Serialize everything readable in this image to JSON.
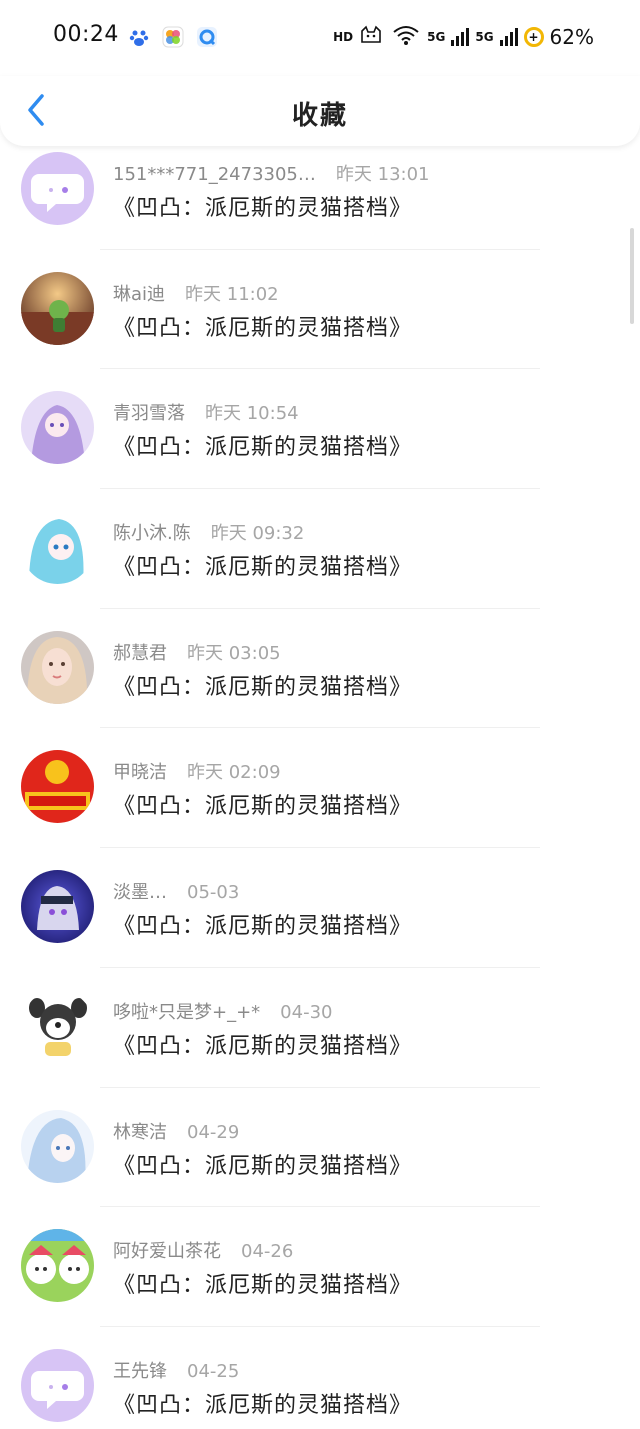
{
  "status_bar": {
    "time": "00:24",
    "hd_label": "HD",
    "sim1_label": "5G",
    "sim2_label": "5G",
    "battery_percent": "62%",
    "battery_symbol": "+"
  },
  "header": {
    "title": "收藏",
    "back_icon": "chevron-left-icon"
  },
  "list": {
    "items": [
      {
        "name": "151***771_2473305…",
        "time": "昨天 13:01",
        "subject": "《凹凸：派厄斯的灵猫搭档》"
      },
      {
        "name": "琳ai迪",
        "time": "昨天 11:02",
        "subject": "《凹凸：派厄斯的灵猫搭档》"
      },
      {
        "name": "青羽雪落",
        "time": "昨天 10:54",
        "subject": "《凹凸：派厄斯的灵猫搭档》"
      },
      {
        "name": "陈小沐.陈",
        "time": "昨天 09:32",
        "subject": "《凹凸：派厄斯的灵猫搭档》"
      },
      {
        "name": "郝慧君",
        "time": "昨天 03:05",
        "subject": "《凹凸：派厄斯的灵猫搭档》"
      },
      {
        "name": "甲晓洁",
        "time": "昨天 02:09",
        "subject": "《凹凸：派厄斯的灵猫搭档》"
      },
      {
        "name": "淡墨…",
        "time": "05-03",
        "subject": "《凹凸：派厄斯的灵猫搭档》"
      },
      {
        "name": "哆啦*只是梦+_+*",
        "time": "04-30",
        "subject": "《凹凸：派厄斯的灵猫搭档》"
      },
      {
        "name": "林寒洁",
        "time": "04-29",
        "subject": "《凹凸：派厄斯的灵猫搭档》"
      },
      {
        "name": "阿好爱山茶花",
        "time": "04-26",
        "subject": "《凹凸：派厄斯的灵猫搭档》"
      },
      {
        "name": "王先锋",
        "time": "04-25",
        "subject": "《凹凸：派厄斯的灵猫搭档》"
      }
    ]
  },
  "colors": {
    "accent": "#2f8cf0",
    "default_avatar_bg": "#d7c4f5",
    "meta_text": "#8a8a8a",
    "subject_text": "#222222"
  }
}
